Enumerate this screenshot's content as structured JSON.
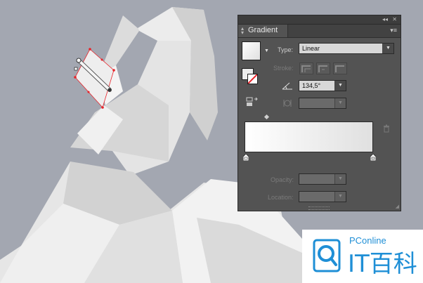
{
  "panel": {
    "tab_label": "Gradient",
    "collapse_label": "◂◂",
    "close_label": "✕",
    "menu_label": "▾≡",
    "type_label": "Type:",
    "type_value": "Linear",
    "stroke_label": "Stroke:",
    "angle_value": "134,5°",
    "aspect_value": "",
    "opacity_label": "Opacity:",
    "opacity_value": "",
    "location_label": "Location:",
    "location_value": ""
  },
  "gradient": {
    "start_color": "#ffffff",
    "end_color": "#e0e0e0",
    "angle": 134.5
  },
  "canvas": {
    "background": "#a3a7b1",
    "selection_color": "#e8232a"
  },
  "watermark": {
    "brand_text": "PConline",
    "logo_text": "IT百科",
    "color": "#1f8fd6"
  }
}
